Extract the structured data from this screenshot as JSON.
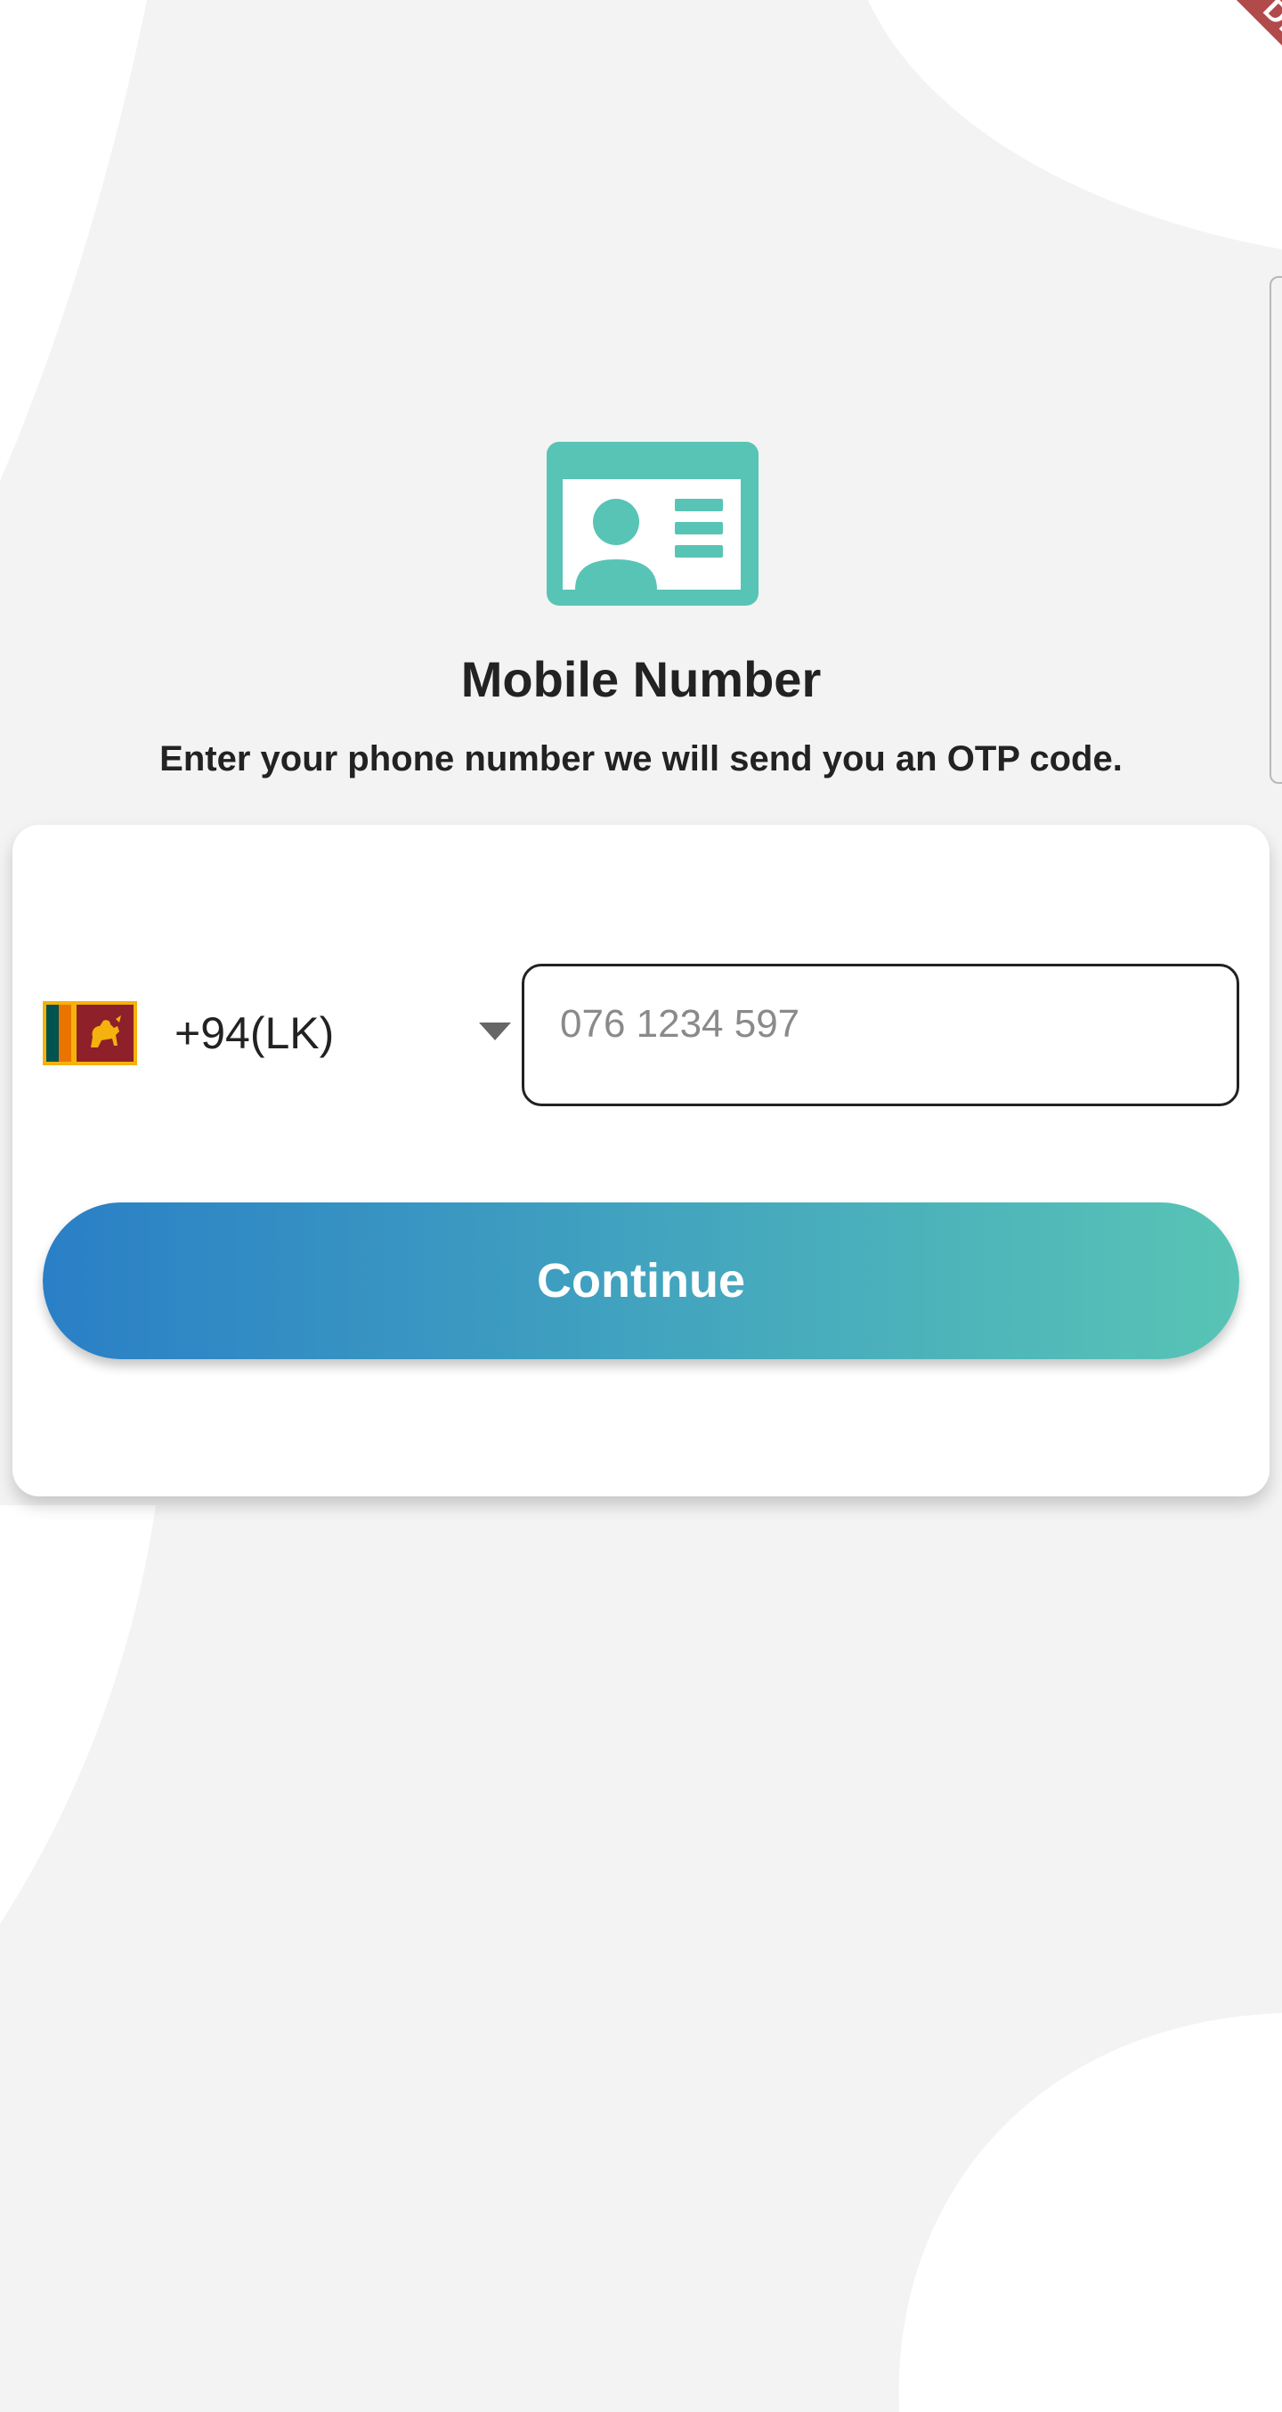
{
  "debug_banner": {
    "label": "DEBUG"
  },
  "header": {
    "icon": "id-card-icon",
    "title": "Mobile Number",
    "subtitle": "Enter your phone number we will send you an OTP code."
  },
  "form": {
    "country": {
      "flag": "sri-lanka-flag-icon",
      "code_label": "+94(LK)",
      "dropdown_icon": "caret-down-icon"
    },
    "phone": {
      "placeholder": "076 1234 597",
      "value": ""
    },
    "continue_label": "Continue"
  },
  "colors": {
    "accent_teal": "#58c4b5",
    "gradient_start": "#2a7fc6",
    "gradient_end": "#58c4b5",
    "debug_banner": "#b14a4a",
    "background": "#f3f3f3"
  }
}
